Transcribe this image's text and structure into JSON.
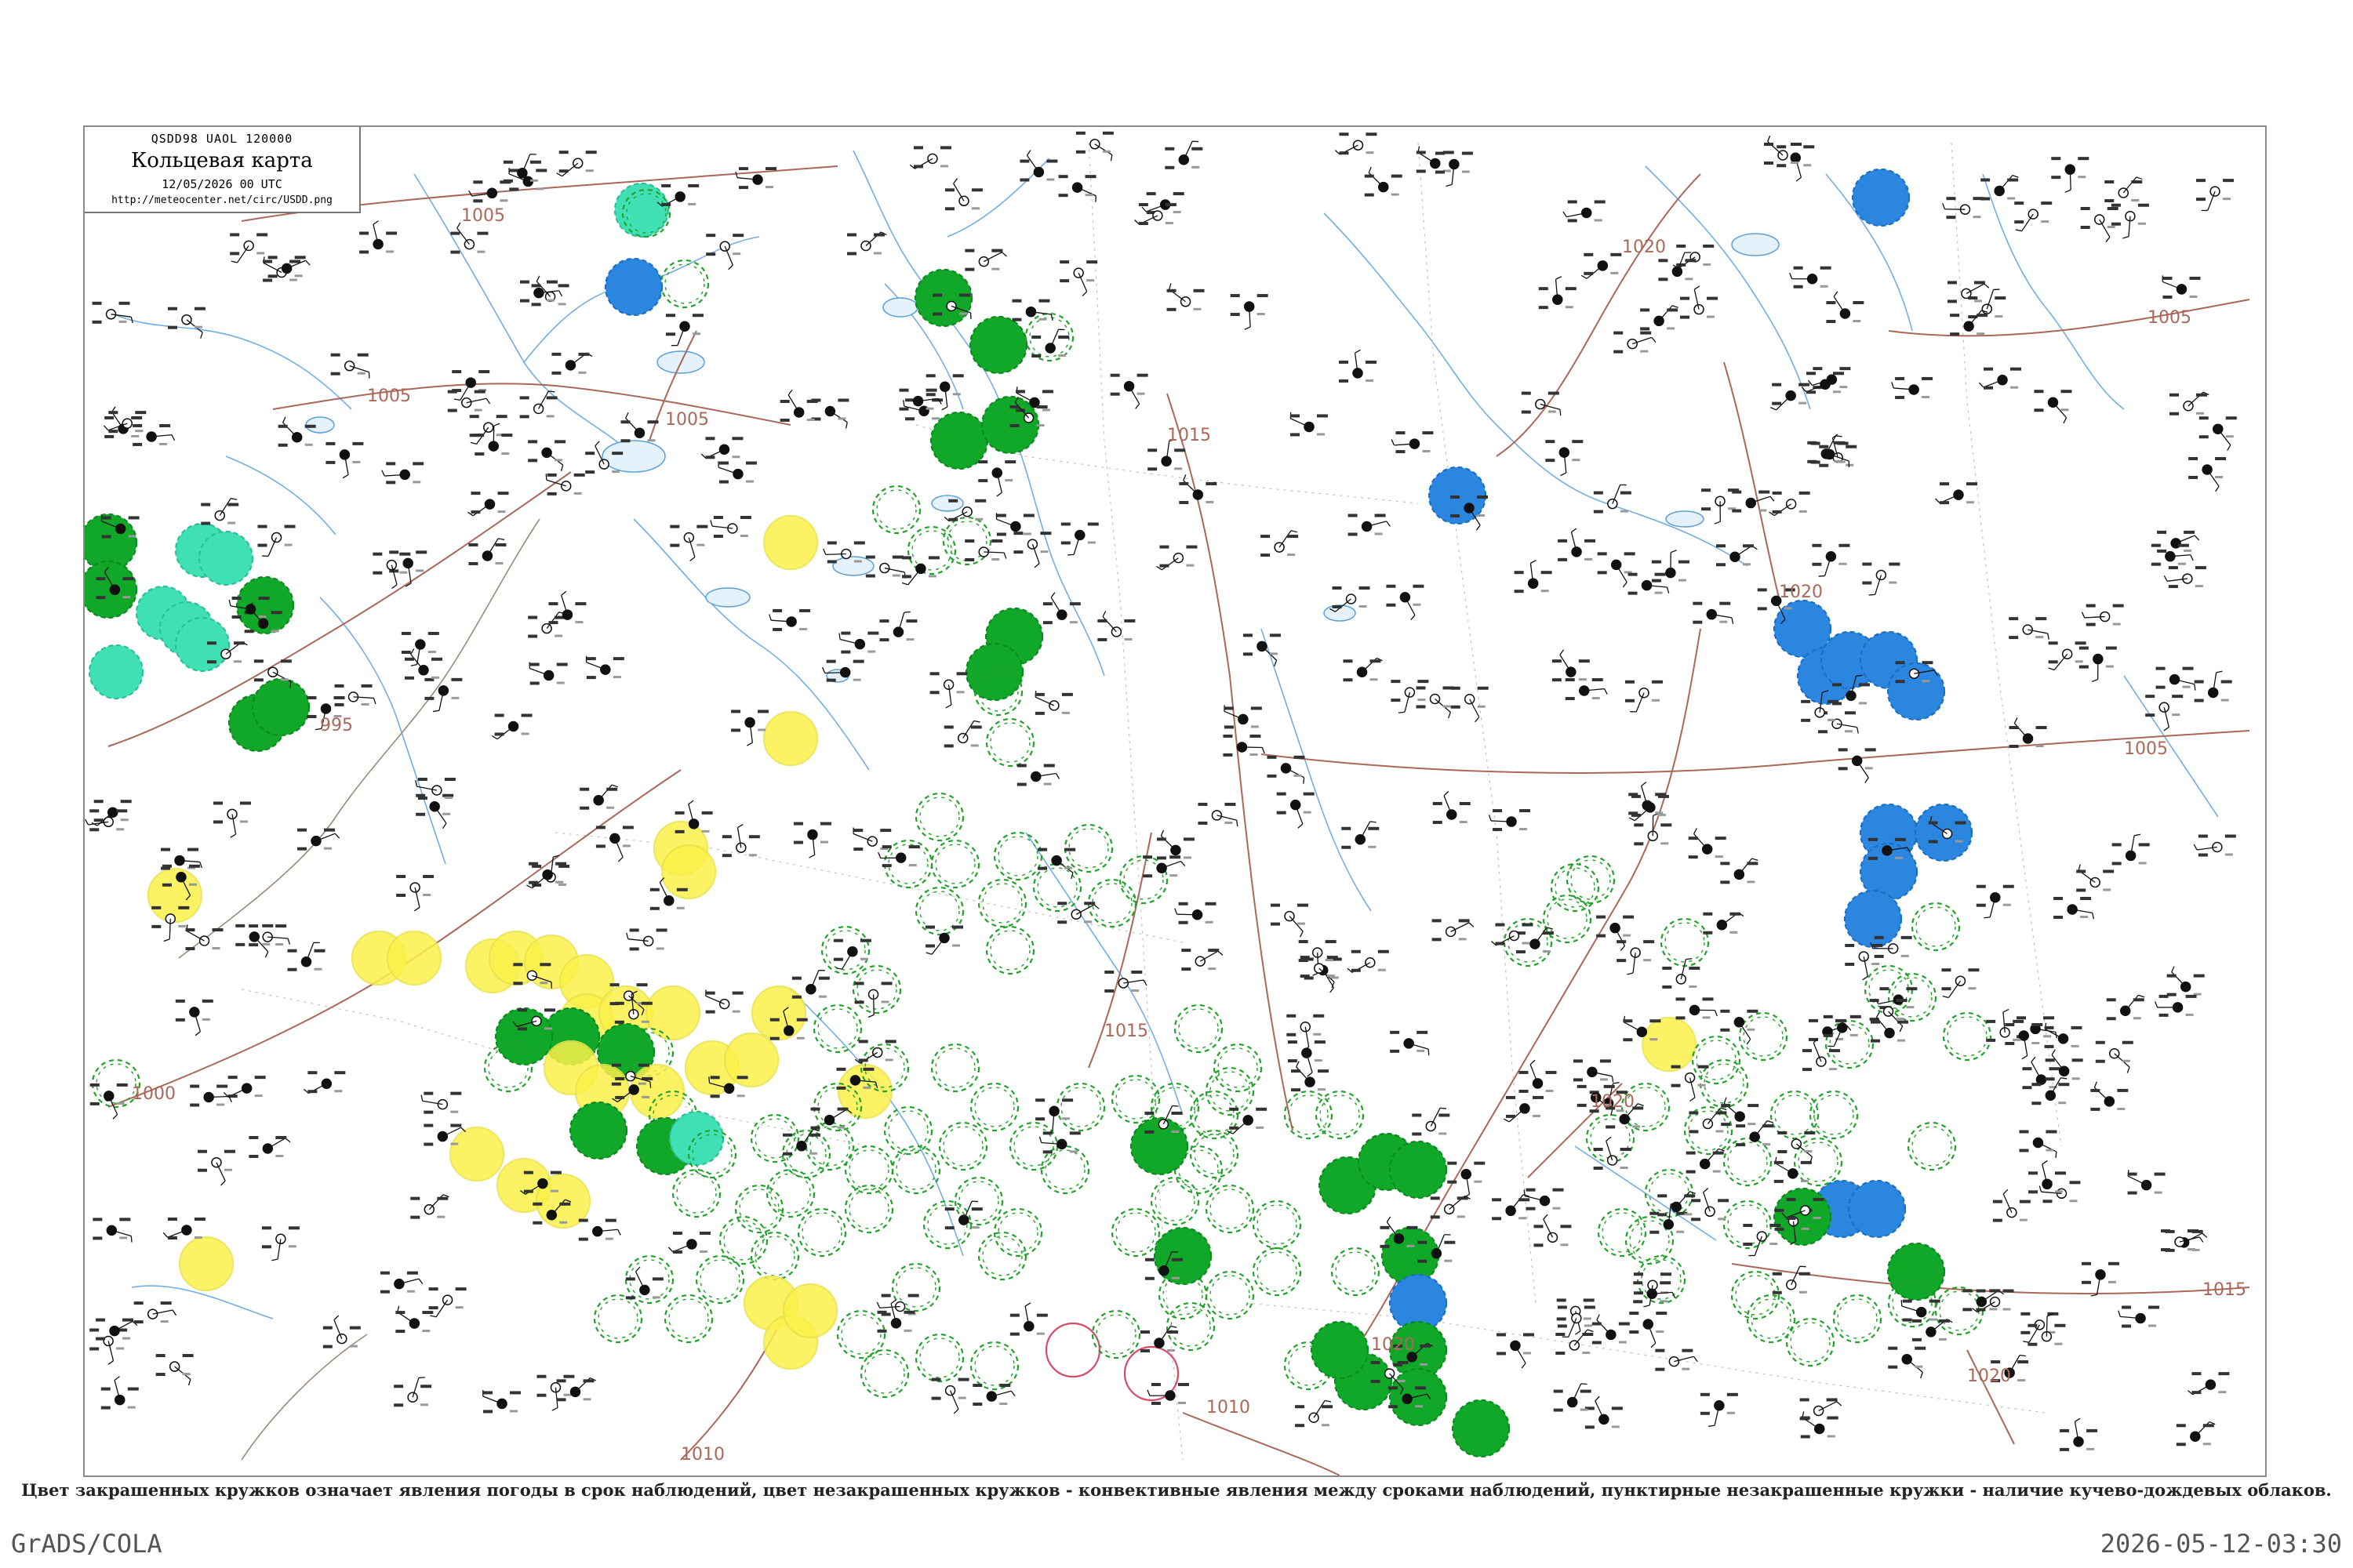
{
  "header": {
    "chart_code": "QSDD98  UAOL  120000",
    "title": "Кольцевая карта",
    "date": "12/05/2026 00 UTC",
    "url": "http://meteocenter.net/circ/USDD.png"
  },
  "isobars": [
    {
      "id": "isobar-995",
      "label": "995"
    },
    {
      "id": "isobar-1000",
      "label": "1000"
    },
    {
      "id": "isobar-1005",
      "label": "1005"
    },
    {
      "id": "isobar-1010",
      "label": "1010"
    },
    {
      "id": "isobar-1015",
      "label": "1015"
    },
    {
      "id": "isobar-1020",
      "label": "1020"
    }
  ],
  "circle_colors": {
    "rain": "#11a82a",
    "shower": "#2b86e0",
    "fog": "#3fe0b4",
    "haze": "#fbf14a",
    "dust": "#ffe866",
    "convective_ring": "#22a22a",
    "thunder_ring": "#d84a6a"
  },
  "map_colors": {
    "isobar": "#a9685a",
    "coast": "#5aa0dd",
    "border": "#9a8a7a",
    "station": "#111111"
  },
  "legend_note": "Цвет закрашенных кружков означает явления погоды в срок наблюдений, цвет незакрашенных кружков - конвективные явления между сроками наблюдений, пунктирные незакрашенные кружки - наличие кучево-дождевых облаков.",
  "footer": {
    "left": "GrADS/COLA",
    "right": "2026-05-12-03:30"
  }
}
